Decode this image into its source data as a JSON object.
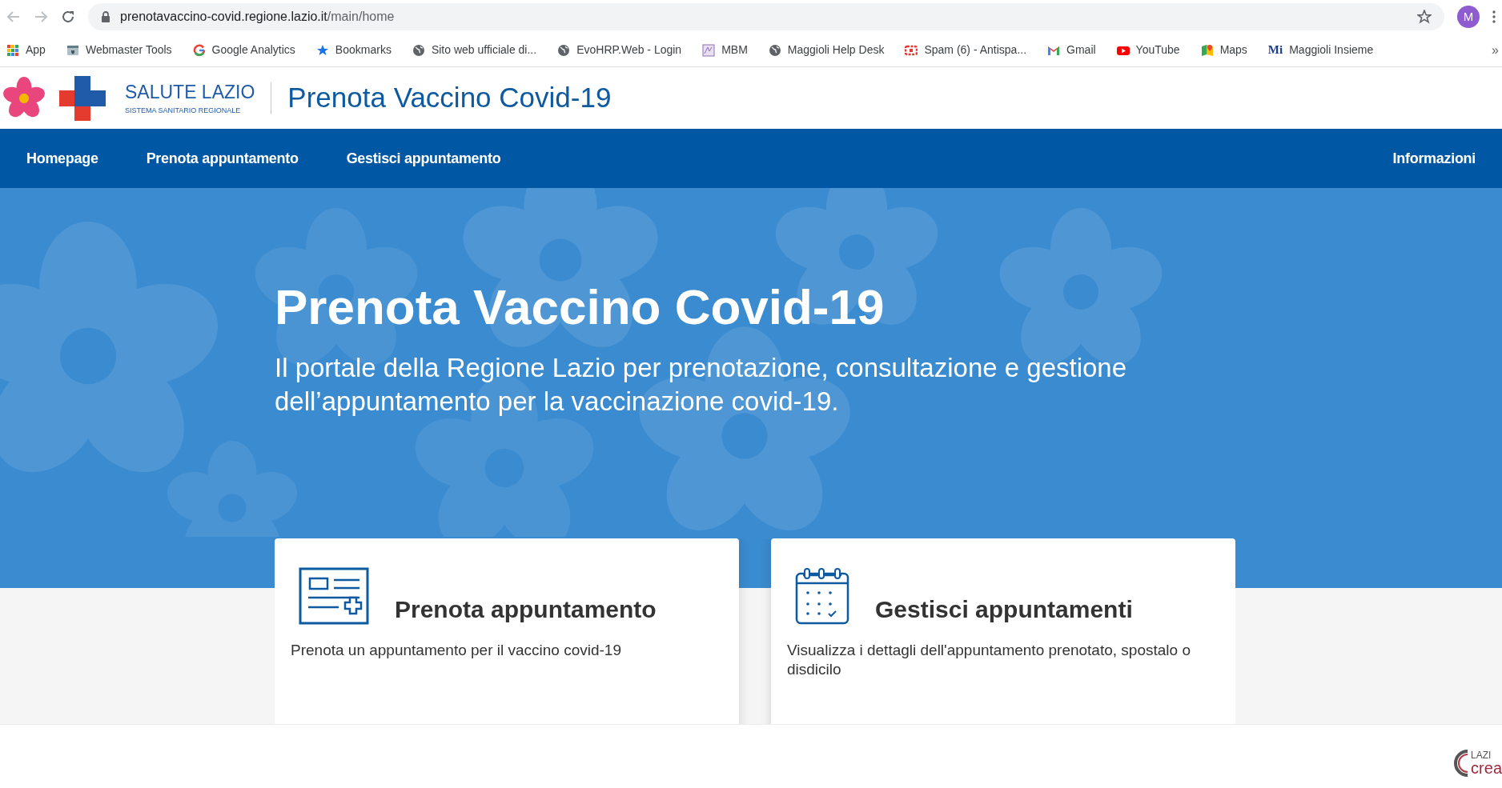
{
  "browser": {
    "url_host": "prenotavaccino-covid.regione.lazio.it",
    "url_path": "/main/home",
    "profile_initial": "M"
  },
  "bookmarks": [
    {
      "kind": "apps",
      "label": "App"
    },
    {
      "kind": "webmaster",
      "label": "Webmaster Tools"
    },
    {
      "kind": "google",
      "label": "Google Analytics"
    },
    {
      "kind": "star",
      "label": "Bookmarks"
    },
    {
      "kind": "globe",
      "label": "Sito web ufficiale di..."
    },
    {
      "kind": "globe",
      "label": "EvoHRP.Web - Login"
    },
    {
      "kind": "mbm",
      "label": "MBM"
    },
    {
      "kind": "globe",
      "label": "Maggioli Help Desk"
    },
    {
      "kind": "spam",
      "label": "Spam (6) - Antispa..."
    },
    {
      "kind": "gmail",
      "label": "Gmail"
    },
    {
      "kind": "youtube",
      "label": "YouTube"
    },
    {
      "kind": "maps",
      "label": "Maps"
    },
    {
      "kind": "mi",
      "badge": "Mi",
      "label": "Maggioli Insieme"
    }
  ],
  "bookmarks_more": "»",
  "header": {
    "brand": "SALUTE LAZIO",
    "brand_sub": "SISTEMA SANITARIO REGIONALE",
    "title": "Prenota Vaccino Covid-19"
  },
  "nav": {
    "left": [
      "Homepage",
      "Prenota appuntamento",
      "Gestisci appuntamento"
    ],
    "right": [
      "Informazioni"
    ]
  },
  "hero": {
    "title": "Prenota Vaccino Covid-19",
    "subtitle": "Il portale della Regione Lazio per prenotazione, consultazione e gestione dell’appuntamento per la vaccinazione covid-19."
  },
  "cards": [
    {
      "kind": "form",
      "title": "Prenota appuntamento",
      "text": "Prenota un appuntamento per il vaccino covid-19"
    },
    {
      "kind": "calendar",
      "title": "Gestisci appuntamenti",
      "text": "Visualizza i dettagli dell'appuntamento prenotato, spostalo o disdicilo"
    }
  ],
  "footer": {
    "logo_top": "LAZI",
    "logo_bottom": "crea"
  }
}
